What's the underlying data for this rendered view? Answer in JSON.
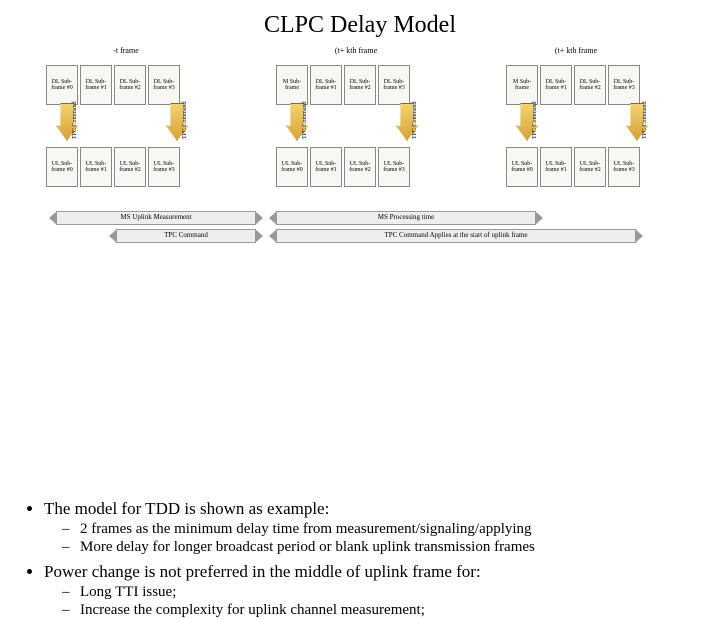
{
  "title": "CLPC Delay Model",
  "frame_labels": [
    "-t   frame",
    "(t+ kth frame",
    "(t+  kth frame"
  ],
  "dl_subframes": [
    [
      "DL Sub-frame #0",
      "DL Sub-frame #1",
      "DL Sub-frame #2",
      "DL Sub-frame #3"
    ],
    [
      "M Sub-frame",
      "DL Sub-frame #1",
      "DL Sub-frame #2",
      "DL Sub-frame #3"
    ],
    [
      "M Sub-frame",
      "DL Sub-frame #1",
      "DL Sub-frame #2",
      "DL Sub-frame #3"
    ]
  ],
  "ul_subframes": [
    [
      "UL Sub-frame #0",
      "UL Sub-frame #1",
      "UL Sub-frame #2",
      "UL Sub-frame #3"
    ],
    [
      "UL Sub-frame #0",
      "UL Sub-frame #1",
      "UL Sub-frame #2",
      "UL Sub-frame #3"
    ],
    [
      "UL Sub-frame #0",
      "UL Sub-frame #1",
      "UL Sub-frame #2",
      "UL Sub-frame #3"
    ]
  ],
  "tpc_label": "TPC Command",
  "bar_top_left": "MS Uplink Measurement",
  "bar_top_right": "MS Processing time",
  "bar_bottom_left": "TPC Command",
  "bar_bottom_right": "TPC Command Applies at the start of uplink frame",
  "bullets": {
    "b1": "The model for TDD is shown as example:",
    "b1s1": "2 frames as the minimum delay time from measurement/signaling/applying",
    "b1s2": "More delay for longer broadcast period or blank uplink transmission frames",
    "b2": "Power change is not preferred in the middle of uplink frame for:",
    "b2s1": "Long TTI issue;",
    "b2s2": "Increase the complexity for uplink channel measurement;"
  }
}
